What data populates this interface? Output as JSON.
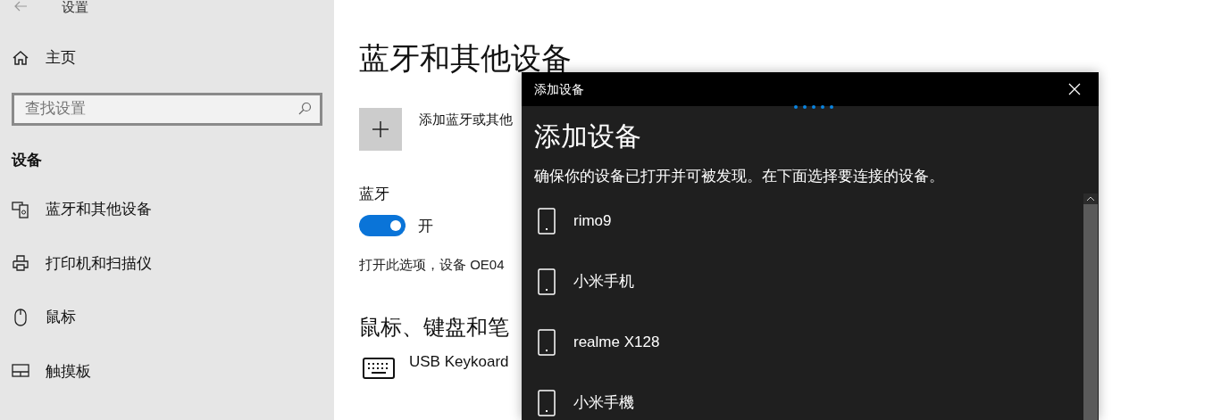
{
  "window": {
    "title": "设置"
  },
  "sidebar": {
    "home": "主页",
    "search": {
      "placeholder": "查找设置"
    },
    "section": "设备",
    "items": [
      {
        "label": "蓝牙和其他设备"
      },
      {
        "label": "打印机和扫描仪"
      },
      {
        "label": "鼠标"
      },
      {
        "label": "触摸板"
      }
    ]
  },
  "main": {
    "heading": "蓝牙和其他设备",
    "add_device": "添加蓝牙或其他",
    "bluetooth": {
      "label": "蓝牙",
      "on": true,
      "state_text": "开"
    },
    "description": "打开此选项，设备 OE04",
    "section": "鼠标、键盘和笔",
    "keyboard": "USB Keykoard"
  },
  "dialog": {
    "title": "添加设备",
    "heading": "添加设备",
    "instruction": "确保你的设备已打开并可被发现。在下面选择要连接的设备。",
    "devices": [
      {
        "name": "rimo9"
      },
      {
        "name": "小米手机"
      },
      {
        "name": "realme X128"
      },
      {
        "name": "小米手機"
      }
    ]
  }
}
